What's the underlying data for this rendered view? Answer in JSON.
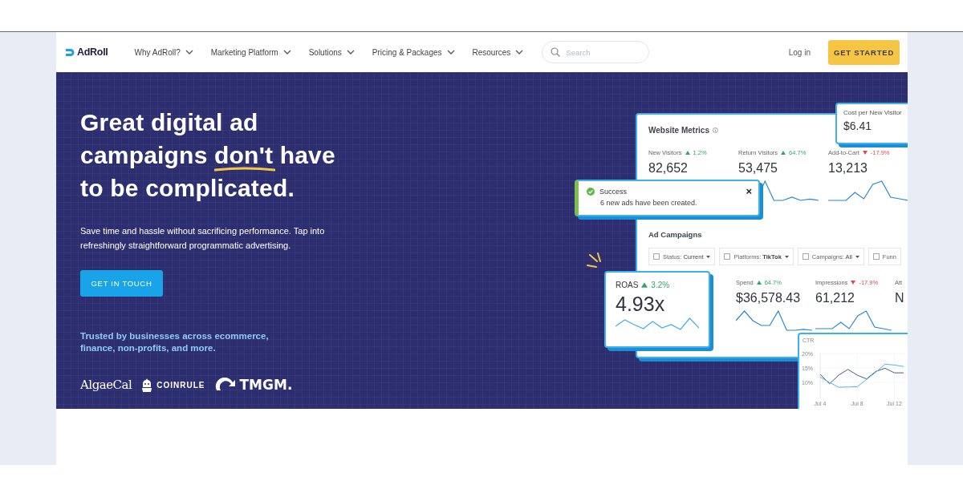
{
  "nav": {
    "logo": "AdRoll",
    "menu": [
      {
        "label": "Why AdRoll?"
      },
      {
        "label": "Marketing Platform"
      },
      {
        "label": "Solutions"
      },
      {
        "label": "Pricing & Packages"
      },
      {
        "label": "Resources"
      }
    ],
    "search": {
      "placeholder": "Search"
    },
    "login": "Log in",
    "cta": "GET STARTED"
  },
  "hero": {
    "heading": {
      "before": "Great digital ad campaigns ",
      "underlined": "don't",
      "after": " have to be complicated."
    },
    "text": "Save time and hassle without sacrificing performance. Tap into refreshingly straightforward programmatic advertising.",
    "button": "GET IN TOUCH",
    "trusted": "Trusted by businesses across ecommerce, finance, non-profits, and more.",
    "logos": [
      {
        "kind": "algae",
        "text": "AlgaeCal"
      },
      {
        "kind": "coinrule",
        "text": "COINRULE"
      },
      {
        "kind": "tmgm",
        "text": "TMGM."
      }
    ]
  },
  "dashboard": {
    "title": "Website Metrics",
    "metrics": [
      {
        "label": "New Visitors",
        "change": "1.2%",
        "up": true,
        "value": "82,652"
      },
      {
        "label": "Return Visitors",
        "change": "64.7%",
        "up": true,
        "value": "53,475"
      },
      {
        "label": "Add-to-Cart",
        "change": "-17.9%",
        "up": false,
        "value": "13,213"
      }
    ],
    "campaigns_title": "Ad Campaigns",
    "filters": [
      {
        "label": "Status:",
        "value": "Current",
        "checked": false
      },
      {
        "label": "Platforms:",
        "value": "TikTok",
        "checked": false
      },
      {
        "label": "Campaigns:",
        "value": "All",
        "checked": false
      },
      {
        "label": "Funn",
        "checked": false
      }
    ],
    "campaign_metrics": [
      {
        "label": "Spend",
        "change": "64.7%",
        "up": true,
        "value": "$36,578.43"
      },
      {
        "label": "Impressions",
        "change": "-17.9%",
        "up": false,
        "value": "61,212"
      },
      {
        "label": "Att",
        "value": "N"
      }
    ],
    "cost_card": {
      "label": "Cost per New Visitor",
      "value": "$6.41"
    },
    "toast": {
      "title": "Success",
      "message": "6 new ads have been created.",
      "close": "×"
    },
    "roas": {
      "label": "ROAS",
      "change": "3.2%",
      "up": true,
      "value": "4.93x"
    },
    "ctr": {
      "chart_data": {
        "type": "line",
        "title": "CTR",
        "categories": [
          "Jul 4",
          null,
          null,
          null,
          "Jul 8",
          null,
          null,
          null,
          "Jul 12",
          null
        ],
        "series": [
          {
            "color": "#4a5a8c",
            "values": [
              12.8,
              9.5,
              12.5,
              14.5,
              12.5,
              11.2,
              13.8,
              14.9,
              13.3,
              13.3
            ]
          },
          {
            "color": "#4fb3e8",
            "values": [
              11.8,
              10,
              8.3,
              8.4,
              8.5,
              11,
              13.5,
              16.3,
              16,
              15.5
            ]
          }
        ],
        "ylim": [
          5,
          20
        ],
        "yticks": [
          {
            "value": 10,
            "label": "10%"
          },
          {
            "value": 15,
            "label": "15%"
          },
          {
            "value": 20,
            "label": "20%"
          }
        ]
      }
    }
  }
}
